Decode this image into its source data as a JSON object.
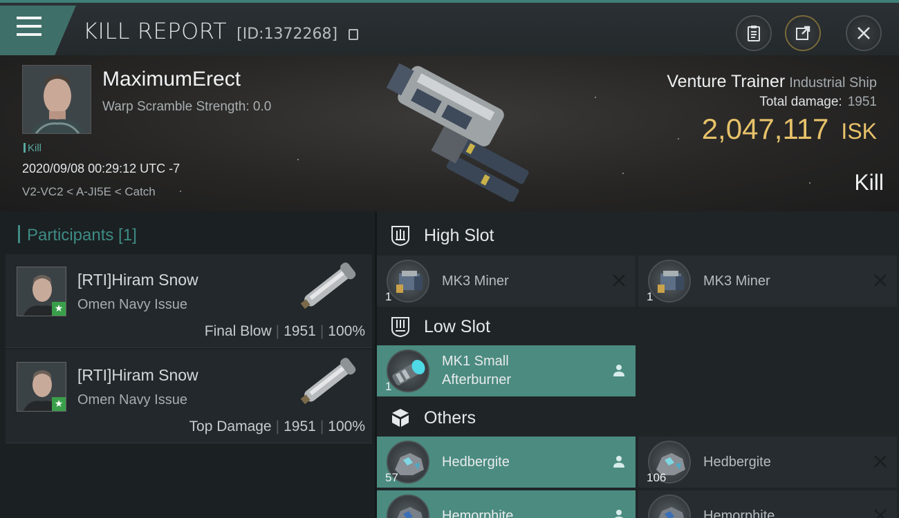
{
  "header": {
    "title": "KILL REPORT",
    "report_id": "[ID:1372268]"
  },
  "pilot": {
    "name": "MaximumErect",
    "warp_scramble": "Warp Scramble Strength: 0.0",
    "tag": "Kill",
    "datetime": "2020/09/08 00:29:12 UTC -7",
    "location": "V2-VC2 < A-JI5E < Catch"
  },
  "ship": {
    "name": "Venture Trainer",
    "class": "Industrial Ship",
    "total_damage_label": "Total damage:",
    "total_damage": "1951",
    "isk_value": "2,047,117",
    "isk_unit": "ISK",
    "result": "Kill"
  },
  "participants": {
    "header": "Participants [1]",
    "rows": [
      {
        "name": "[RTI]Hiram Snow",
        "ship": "Omen Navy Issue",
        "role": "Final Blow",
        "damage": "1951",
        "percent": "100%"
      },
      {
        "name": "[RTI]Hiram Snow",
        "ship": "Omen Navy Issue",
        "role": "Top Damage",
        "damage": "1951",
        "percent": "100%"
      }
    ]
  },
  "slots": {
    "high": {
      "title": "High Slot",
      "items": [
        {
          "name": "MK3 Miner",
          "qty": "1"
        },
        {
          "name": "MK3 Miner",
          "qty": "1"
        }
      ]
    },
    "low": {
      "title": "Low Slot",
      "items": [
        {
          "name_line1": "MK1 Small",
          "name_line2": "Afterburner",
          "qty": "1"
        }
      ]
    },
    "others": {
      "title": "Others",
      "items": [
        {
          "name": "Hedbergite",
          "qty": "57"
        },
        {
          "name": "Hedbergite",
          "qty": "106"
        },
        {
          "name": "Hemorphite",
          "qty": ""
        },
        {
          "name": "Hemorphite",
          "qty": ""
        }
      ]
    }
  },
  "colors": {
    "accent_teal": "#4b8b80",
    "isk_gold": "#e7c26a",
    "header_bg": "#2b3034"
  }
}
